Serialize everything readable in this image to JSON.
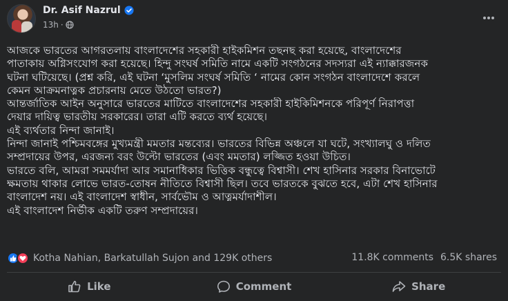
{
  "post": {
    "author": "Dr. Asif Nazrul",
    "time": "13h",
    "dot": "·",
    "paragraphs": [
      "আজকে ভারতের আগরতলায় বাংলাদেশের সহকারী হাইকমিশন তছনছ করা হয়েছে, বাংলাদেশের",
      "পাতাকায় অগ্নিসংযোগ করা হয়েছে। হিন্দু সংঘর্ষ সমিতি নামে একটি সংগঠনের সদস্যরা এই ন্যাক্কারজনক",
      "ঘটনা ঘটিয়েছে। (প্রশ্ন করি, এই ঘটনা ‘মুসলিম সংঘর্ষ সমিতি ‘ নামের কোন সংগঠন বাংলাদেশে করলে",
      "কেমন আক্রমনাত্নক প্রচারনায় মেতে উঠতো ভারত?)",
      "আন্তর্জাতিক আইন অনুসারে ভারতের মাটিতে বাংলাদেশের সহকারী হাইকিমিশনকে পরিপূর্ণ নিরাপত্তা",
      "দেয়ার দায়িত্ব ভারতীয় সরকারের। তারা এটি করতে ব্যর্থ হয়েছে।",
      "এই ব্যর্থতার নিন্দা জানাই।",
      "নিন্দা জানাই পশ্চিমবঙ্গের মুখ্যমন্ত্রী মমতার মন্তব্যের। ভারতের বিভিন্ন অঞ্চলে যা ঘটে, সংখ্যালঘু ও দলিত",
      "সম্প্রদায়ের উপর, এরজন্য বরং উল্টো ভারতের (এবং মমতার) লজ্জিত হওয়া উচিত।",
      "ভারতে বলি, আমরা সমমর্যাদা আর সমানাধিকার ভিত্তিক বন্ধুত্বে বিশ্বাসী। শেখ হাসিনার সরকার বিনাভোটে",
      "ক্ষমতায় থাকার লোভে ভারত-তোষন নীতিতে বিশ্বাসী ছিল। তবে ভারতকে বুঝতে হবে, এটা শেখ হাসিনার",
      "বাংলাদেশ নয়। এই বাংলাদেশ স্বাধীন, সার্বভৌম ও আত্নমর্যাদাশীল।",
      "এই বাংলাদেশ নির্ভীক একটি তরুণ সম্প্রদায়ের।"
    ]
  },
  "reactions": {
    "names": "Kotha Nahian, Barkatullah Sujon and 129K others",
    "comments": "11.8K comments",
    "shares": "6.5K shares"
  },
  "actions": {
    "like": "Like",
    "comment": "Comment",
    "share": "Share"
  },
  "colors": {
    "background": "#242526",
    "text": "#e4e6eb",
    "secondary": "#b0b3b8",
    "verified": "#1877f2",
    "love": "#f33e58"
  }
}
